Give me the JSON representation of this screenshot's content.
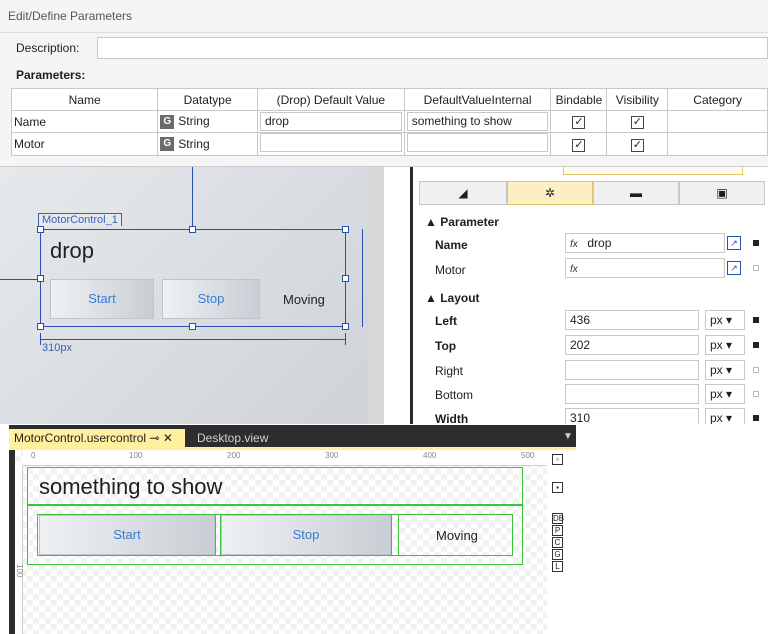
{
  "dialog": {
    "title": "Edit/Define Parameters",
    "description_label": "Description:",
    "description_value": "",
    "parameters_label": "Parameters:",
    "columns": [
      "Name",
      "Datatype",
      "(Drop) Default Value",
      "DefaultValueInternal",
      "Bindable",
      "Visibility",
      "Category"
    ],
    "rows": [
      {
        "name": "Name",
        "datatype_badge": "G",
        "datatype": "String",
        "default_value": "drop",
        "internal": "something to show",
        "bindable": "✓",
        "visibility": "✓"
      },
      {
        "name": "Motor",
        "datatype_badge": "G",
        "datatype": "String",
        "default_value": "",
        "internal": "",
        "bindable": "✓",
        "visibility": "✓"
      }
    ]
  },
  "designer": {
    "control_label": "MotorControl_1",
    "text": "drop",
    "start": "Start",
    "stop": "Stop",
    "moving": "Moving",
    "width_dim": "310px"
  },
  "properties": {
    "parameter_section": "Parameter",
    "layout_section": "Layout",
    "params": [
      {
        "label": "Name",
        "value": "drop",
        "fx": "fx"
      },
      {
        "label": "Motor",
        "value": "",
        "fx": "fx"
      }
    ],
    "layout": [
      {
        "label": "Left",
        "value": "436",
        "unit": "px"
      },
      {
        "label": "Top",
        "value": "202",
        "unit": "px"
      },
      {
        "label": "Right",
        "value": "",
        "unit": "px"
      },
      {
        "label": "Bottom",
        "value": "",
        "unit": "px"
      },
      {
        "label": "Width",
        "value": "310",
        "unit": "px"
      }
    ]
  },
  "editor": {
    "tab_active": "MotorControl.usercontrol",
    "tab_pin": "⊸",
    "tab_close": "✕",
    "tab_inactive": "Desktop.view",
    "ruler_marks": [
      "0",
      "100",
      "200",
      "300",
      "400",
      "500"
    ],
    "ruler_v_mark": "100",
    "text": "something to show",
    "start": "Start",
    "stop": "Stop",
    "moving": "Moving",
    "side_icons": [
      "DB",
      "P",
      "C",
      "G",
      "L"
    ]
  },
  "colors": {
    "selection": "#2b4fb0",
    "accent_tab": "#fff0a0",
    "green_outline": "#3cc33c",
    "button_text": "#3a7bd5"
  }
}
